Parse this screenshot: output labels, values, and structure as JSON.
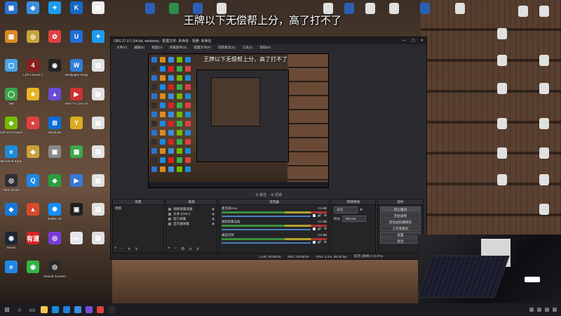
{
  "headline": "王牌以下无偿帮上分，高了打不了",
  "desktop_left": [
    {
      "label": "",
      "color": "#2a72d1",
      "glyph": "▣",
      "name": "pc-icon"
    },
    {
      "label": "",
      "color": "#3b8fe0",
      "glyph": "◆",
      "name": "paper-plane-icon"
    },
    {
      "label": "",
      "color": "#1d9bf0",
      "glyph": "✦",
      "name": "bird-icon"
    },
    {
      "label": "",
      "color": "#1668c9",
      "glyph": "K",
      "name": "k-app-icon"
    },
    {
      "label": "",
      "color": "#eeeeee",
      "glyph": "▤",
      "name": "file-icon"
    },
    {
      "label": "",
      "color": "#d98b23",
      "glyph": "▦",
      "name": "app-icon"
    },
    {
      "label": "",
      "color": "#c8a23a",
      "glyph": "◎",
      "name": "app-icon"
    },
    {
      "label": "",
      "color": "#e04141",
      "glyph": "✿",
      "name": "app-icon"
    },
    {
      "label": "",
      "color": "#1e6fd9",
      "glyph": "U",
      "name": "u-app-icon"
    },
    {
      "label": "",
      "color": "#1d9bf0",
      "glyph": "✦",
      "name": "twitter-icon"
    },
    {
      "label": "",
      "color": "#4aa3e8",
      "glyph": "▢",
      "name": "folder-icon"
    },
    {
      "label": "Left 4 Dead 2",
      "color": "#8a2020",
      "glyph": "4",
      "name": "game-icon"
    },
    {
      "label": "",
      "color": "#222222",
      "glyph": "◉",
      "name": "app-icon"
    },
    {
      "label": "Wallpaper Engine",
      "color": "#2f7fd6",
      "glyph": "W",
      "name": "wallpaper-engine-icon"
    },
    {
      "label": "",
      "color": "#e0e0e0",
      "glyph": "▤",
      "name": "file-icon"
    },
    {
      "label": "360",
      "color": "#3ca34a",
      "glyph": "◯",
      "name": "360-icon"
    },
    {
      "label": "",
      "color": "#e8b323",
      "glyph": "★",
      "name": "app-icon"
    },
    {
      "label": "",
      "color": "#6a4bd6",
      "glyph": "▲",
      "name": "app-icon"
    },
    {
      "label": "WiFi TV Live Online",
      "color": "#cc3333",
      "glyph": "▶",
      "name": "tv-icon"
    },
    {
      "label": "",
      "color": "#e0e0e0",
      "glyph": "▤",
      "name": "file-icon"
    },
    {
      "label": "GeForce Experience",
      "color": "#76b900",
      "glyph": "◆",
      "name": "geforce-icon"
    },
    {
      "label": "",
      "color": "#e04040",
      "glyph": "●",
      "name": "app-icon"
    },
    {
      "label": "Windows",
      "color": "#0a6fd8",
      "glyph": "⊞",
      "name": "windows-icon"
    },
    {
      "label": "",
      "color": "#ddaa22",
      "glyph": "Y",
      "name": "app-icon"
    },
    {
      "label": "",
      "color": "#e0e0e0",
      "glyph": "▤",
      "name": "file-icon"
    },
    {
      "label": "Microsoft Edge",
      "color": "#1b8bd6",
      "glyph": "e",
      "name": "edge-icon"
    },
    {
      "label": "",
      "color": "#c9a23b",
      "glyph": "◆",
      "name": "app-icon"
    },
    {
      "label": "",
      "color": "#8a8a8a",
      "glyph": "▣",
      "name": "app-icon"
    },
    {
      "label": "",
      "color": "#3ba84a",
      "glyph": "▦",
      "name": "app-icon"
    },
    {
      "label": "",
      "color": "#e0e0e0",
      "glyph": "▤",
      "name": "file-icon"
    },
    {
      "label": "OBS Studio",
      "color": "#302e31",
      "glyph": "◎",
      "name": "obs-icon"
    },
    {
      "label": "",
      "color": "#1f88e5",
      "glyph": "Q",
      "name": "app-icon"
    },
    {
      "label": "",
      "color": "#2b9f3e",
      "glyph": "◆",
      "name": "app-icon"
    },
    {
      "label": "",
      "color": "#3a78d8",
      "glyph": "▶",
      "name": "app-icon"
    },
    {
      "label": "",
      "color": "#e0e0e0",
      "glyph": "▤",
      "name": "file-icon"
    },
    {
      "label": "",
      "color": "#1677d8",
      "glyph": "◆",
      "name": "app-icon"
    },
    {
      "label": "",
      "color": "#d84a2a",
      "glyph": "▲",
      "name": "app-icon"
    },
    {
      "label": "Battle.net",
      "color": "#148eff",
      "glyph": "✺",
      "name": "battlenet-icon"
    },
    {
      "label": "",
      "color": "#1f1f22",
      "glyph": "▣",
      "name": "app-icon"
    },
    {
      "label": "",
      "color": "#e0e0e0",
      "glyph": "▤",
      "name": "file-icon"
    },
    {
      "label": "Steam",
      "color": "#1b2838",
      "glyph": "◉",
      "name": "steam-icon"
    },
    {
      "label": "",
      "color": "#d62323",
      "glyph": "有道",
      "name": "youdao-icon"
    },
    {
      "label": "",
      "color": "#7b3ad8",
      "glyph": "◎",
      "name": "app-icon"
    },
    {
      "label": "",
      "color": "#e6e6e6",
      "glyph": "▭",
      "name": "app-icon"
    },
    {
      "label": "",
      "color": "#e0e0e0",
      "glyph": "▤",
      "name": "file-icon"
    },
    {
      "label": "",
      "color": "#1f88e5",
      "glyph": "e",
      "name": "app-icon"
    },
    {
      "label": "",
      "color": "#35b44a",
      "glyph": "◉",
      "name": "wechat-icon"
    },
    {
      "label": "Ubisoft Connect",
      "color": "#2a2a2a",
      "glyph": "◎",
      "name": "ubisoft-icon"
    }
  ],
  "desktop_top": [
    {
      "label": "",
      "color": "#2b5fb5",
      "name": "word-doc-icon"
    },
    {
      "label": "",
      "color": "#2b8f4a",
      "name": "excel-icon"
    },
    {
      "label": "",
      "color": "#2b5fb5",
      "name": "word-doc-icon"
    },
    {
      "label": "",
      "color": "#e0e0e0",
      "name": "file-icon"
    },
    {
      "label": "",
      "color": "#e0e0e0",
      "name": "file-icon"
    },
    {
      "label": "",
      "color": "#2b5fb5",
      "name": "word-doc-icon"
    },
    {
      "label": "",
      "color": "#e0e0e0",
      "name": "file-icon"
    },
    {
      "label": "",
      "color": "#e0e0e0",
      "name": "file-icon"
    },
    {
      "label": "",
      "color": "#2b5fb5",
      "name": "word-doc-icon"
    },
    {
      "label": "",
      "color": "#e0e0e0",
      "name": "file-icon"
    }
  ],
  "desktop_right": [
    {
      "label": "",
      "color": "#e0e0e0",
      "name": "file-icon"
    },
    {
      "label": "",
      "color": "#e0e0e0",
      "name": "file-icon"
    },
    {
      "label": "",
      "color": "#e0e0e0",
      "name": "file-icon"
    },
    {
      "label": "",
      "color": "#e0e0e0",
      "name": "file-icon"
    },
    {
      "label": "",
      "color": "#e0e0e0",
      "name": "file-icon"
    },
    {
      "label": "",
      "color": "#e0e0e0",
      "name": "file-icon"
    },
    {
      "label": "",
      "color": "#e0e0e0",
      "name": "file-icon"
    },
    {
      "label": "",
      "color": "#e0e0e0",
      "name": "file-icon"
    },
    {
      "label": "",
      "color": "#e0e0e0",
      "name": "file-icon"
    },
    {
      "label": "",
      "color": "#e0e0e0",
      "name": "file-icon"
    },
    {
      "label": "",
      "color": "#e0e0e0",
      "name": "file-icon"
    },
    {
      "label": "",
      "color": "#e0e0e0",
      "name": "file-icon"
    },
    {
      "label": "",
      "color": "#e0e0e0",
      "name": "file-icon"
    },
    {
      "label": "",
      "color": "#e0e0e0",
      "name": "file-icon"
    }
  ],
  "obs": {
    "title": "OBS 27.0.1 (64-bit, windows) - 配置文件: 未命名 - 场景: 未命名",
    "menu": [
      "文件(F)",
      "编辑(E)",
      "视图(V)",
      "停靠部件(D)",
      "配置文件(P)",
      "场景集合(S)",
      "工具(T)",
      "帮助(H)"
    ],
    "preview_headline": "王牌以下无偿帮上分，高了打不了",
    "under_preview": [
      "⚙ 属性",
      "⚙ 滤镜"
    ],
    "docks": {
      "scenes": {
        "title": "场景",
        "items": [
          "场景"
        ]
      },
      "sources": {
        "title": "来源",
        "items": [
          "视频采集设备",
          "文本 (GDI+)",
          "窗口采集",
          "显示器采集"
        ]
      },
      "mixer": {
        "title": "混音器",
        "channels": [
          {
            "name": "麦克风/Aux",
            "level": "0.0 dB"
          },
          {
            "name": "视频采集设备",
            "level": "0.0 dB"
          },
          {
            "name": "桌面音频",
            "level": "0.0 dB"
          }
        ]
      },
      "transitions": {
        "title": "转场特效",
        "type": "淡化",
        "duration_label": "时长",
        "duration": "300 ms"
      },
      "controls": {
        "title": "控件",
        "buttons": [
          "停止推流",
          "开始录制",
          "启动虚拟摄像机",
          "工作室模式",
          "设置",
          "退出"
        ]
      }
    },
    "status": {
      "live": "LIVE: 00:00:00",
      "rec": "REC: 00:00:00",
      "cpu": "CPU: 1.1%, 60.00 fps",
      "drops": "延迟 (丢帧) 0 (0.0%)"
    }
  },
  "taskbar": {
    "apps": [
      {
        "color": "#f2c94c",
        "name": "file-explorer-icon"
      },
      {
        "color": "#1b8bd6",
        "name": "edge-icon"
      },
      {
        "color": "#1d7fd8",
        "name": "mail-icon"
      },
      {
        "color": "#3b8fe0",
        "name": "app-icon"
      },
      {
        "color": "#7a4bd6",
        "name": "app-icon"
      },
      {
        "color": "#e04040",
        "name": "app-icon"
      },
      {
        "color": "#2b2b2b",
        "name": "obs-icon"
      }
    ]
  }
}
